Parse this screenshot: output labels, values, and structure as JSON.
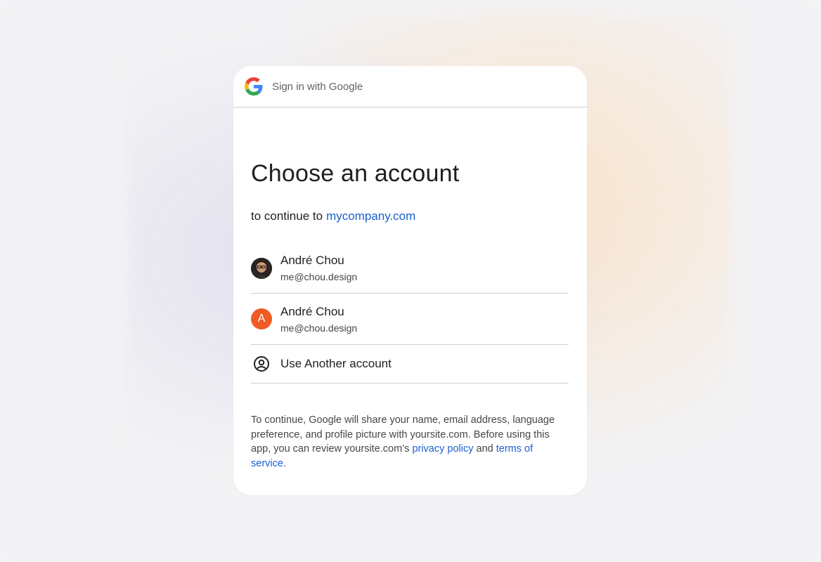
{
  "header": {
    "title": "Sign in with Google",
    "logo_icon": "google-g-icon"
  },
  "main": {
    "title": "Choose an account",
    "subtitle_prefix": "to continue to",
    "subtitle_link": "mycompany.com"
  },
  "accounts": [
    {
      "name": "André Chou",
      "email": "me@chou.design",
      "avatar": "photo"
    },
    {
      "name": "André Chou",
      "email": "me@chou.design",
      "avatar": "letter",
      "avatar_letter": "A",
      "avatar_color": "#f15a24"
    }
  ],
  "another_account": {
    "label": "Use Another account",
    "icon": "account-circle-icon"
  },
  "disclaimer": {
    "text": "To continue, Google will share your name, email address, language preference, and profile picture with yoursite.com. Before using this app, you can review yoursite.com’s",
    "privacy_link": "privacy policy",
    "and_text": "and",
    "terms_link": "terms of service",
    "end": "."
  },
  "colors": {
    "link": "#1a5fd0",
    "accent_avatar": "#f15a24",
    "text": "#1f1f1f",
    "divider": "#cfcfd3"
  }
}
